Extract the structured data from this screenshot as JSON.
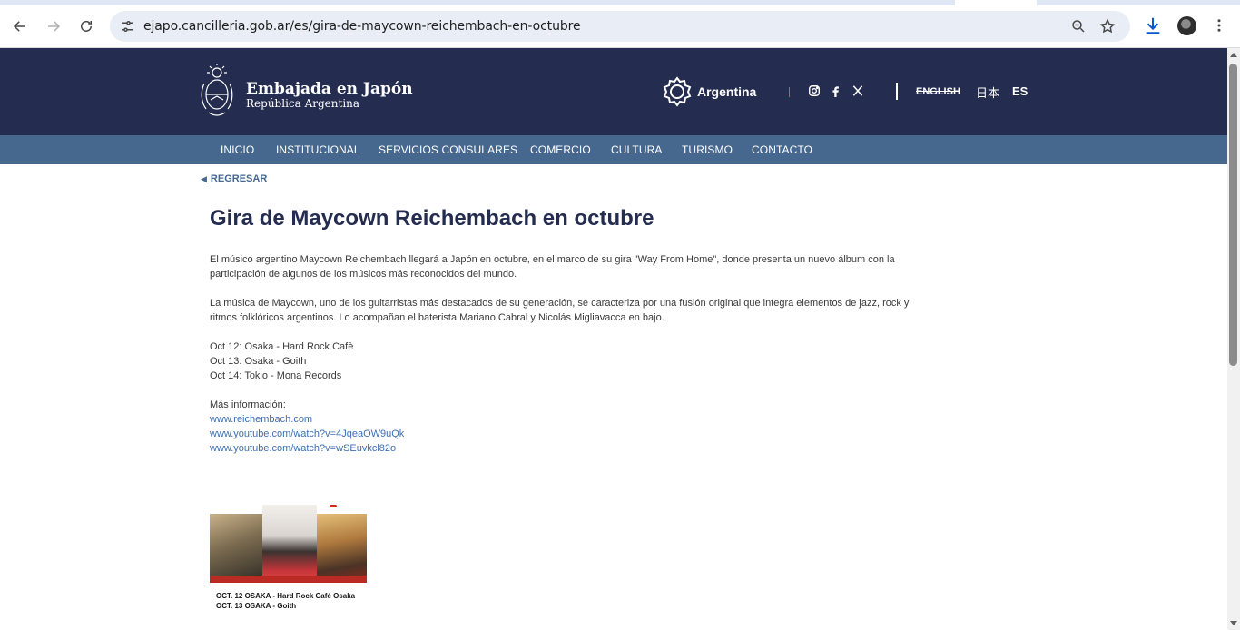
{
  "browser": {
    "url": "ejapo.cancilleria.gob.ar/es/gira-de-maycown-reichembach-en-octubre"
  },
  "header": {
    "title": "Embajada en Japón",
    "subtitle": "República Argentina",
    "brand_text": "Argentina",
    "languages": {
      "english": "ENGLISH",
      "japanese": "日本",
      "spanish": "ES"
    },
    "colors": {
      "header_bg": "#242c4f",
      "nav_bg": "#46678e",
      "accent_red": "#e3476b"
    }
  },
  "nav": {
    "items": [
      "INICIO",
      "INSTITUCIONAL",
      "SERVICIOS CONSULARES",
      "COMERCIO",
      "CULTURA",
      "TURISMO",
      "CONTACTO"
    ]
  },
  "article": {
    "back_label": "REGRESAR",
    "title": "Gira de Maycown Reichembach en octubre",
    "para1_line1": "El músico argentino Maycown Reichembach llegará a Japón en octubre, en el marco de su gira \"Way From Home\", donde presenta un nuevo álbum con la",
    "para1_line2": "participación de algunos de los músicos más reconocidos del mundo.",
    "para2_line1": "La música de Maycown, uno de los guitarristas más destacados de su generación, se caracteriza por una fusión original que integra elementos de jazz, rock y",
    "para2_line2": "ritmos folklóricos argentinos. Lo acompañan el baterista Mariano Cabral y Nicolás Migliavacca en bajo.",
    "dates": [
      "Oct 12: Osaka - Hard Rock Cafè",
      "Oct 13: Osaka - Goith",
      "Oct 14: Tokio - Mona Records"
    ],
    "more_info_label": "Más información:",
    "links": [
      "www.reichembach.com",
      "www.youtube.com/watch?v=4JqeaOW9uQk",
      "www.youtube.com/watch?v=wSEuvkcl82o"
    ],
    "poster_captions": [
      "OCT. 12  OSAKA - Hard Rock Café Osaka",
      "OCT. 13  OSAKA - Goith"
    ]
  }
}
